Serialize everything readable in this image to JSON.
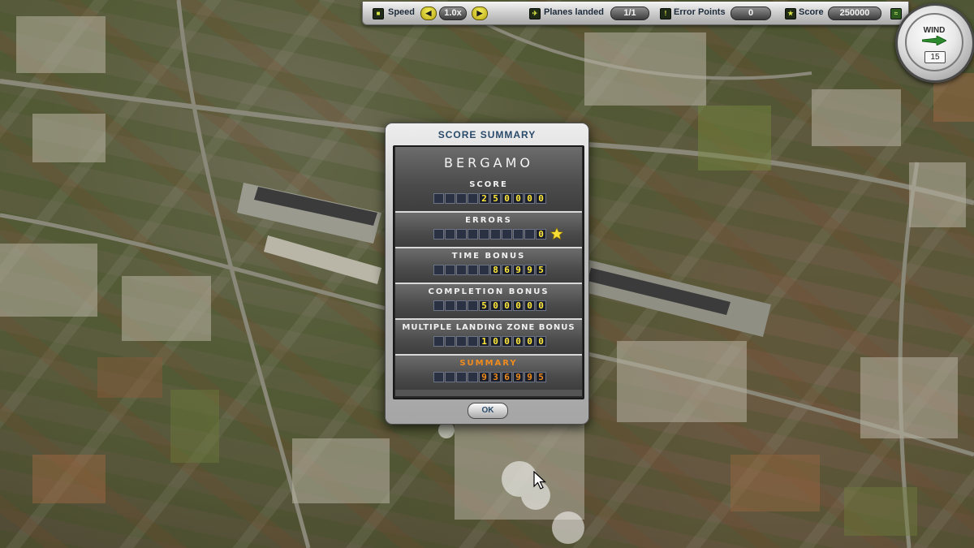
{
  "hud": {
    "speed_label": "Speed",
    "speed_value": "1.0x",
    "planes_landed_label": "Planes landed",
    "planes_landed_value": "1/1",
    "error_points_label": "Error Points",
    "error_points_value": "0",
    "score_label": "Score",
    "score_value": "250000"
  },
  "wind": {
    "label": "WIND",
    "speed": "15"
  },
  "dialog": {
    "title": "SCORE SUMMARY",
    "city": "BERGAMO",
    "rows": [
      {
        "label": "SCORE",
        "value": "250000"
      },
      {
        "label": "ERRORS",
        "value": "0"
      },
      {
        "label": "TIME BONUS",
        "value": "86995"
      },
      {
        "label": "COMPLETION BONUS",
        "value": "500000"
      },
      {
        "label": "MULTIPLE LANDING ZONE BONUS",
        "value": "100000"
      },
      {
        "label": "SUMMARY",
        "value": "936995"
      }
    ],
    "ok_label": "OK"
  },
  "colors": {
    "digit_yellow": "#ffe93a",
    "summary_orange": "#f08c1e",
    "title_blue": "#2a4a6a"
  },
  "icons": [
    "speed-icon",
    "plane-icon",
    "error-icon",
    "score-icon",
    "sound-icon",
    "star-icon",
    "wind-arrow-icon",
    "cursor-icon"
  ]
}
